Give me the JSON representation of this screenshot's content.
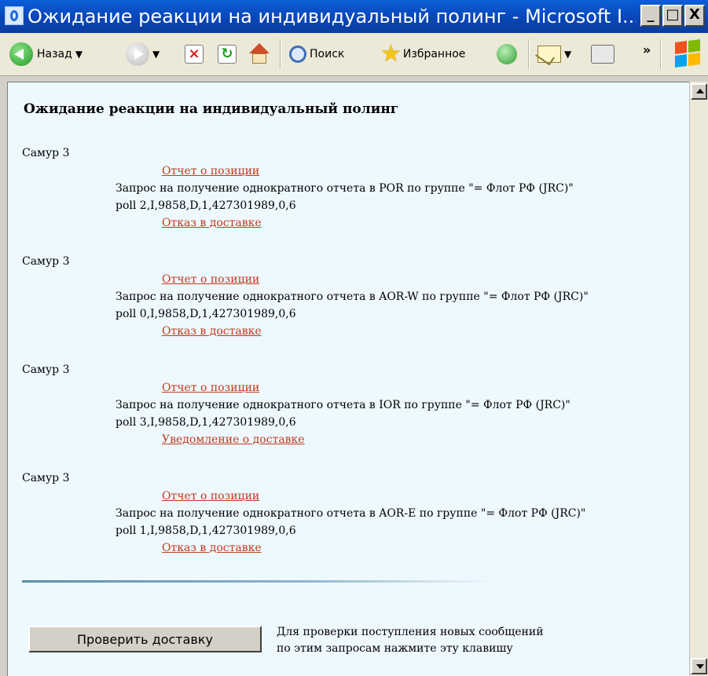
{
  "window": {
    "title": "Ожидание реакции на индивидуальный полинг - Microsoft I...",
    "buttons": {
      "minimize": "_",
      "maximize": "□",
      "close": "X"
    }
  },
  "toolbar": {
    "back_label": "Назад",
    "search_label": "Поиск",
    "favorites_label": "Избранное",
    "chevron": "»"
  },
  "page": {
    "heading": "Ожидание реакции на индивидуальный полинг",
    "entries": [
      {
        "sender": "Самур 3",
        "report_link": "Отчет о позиции",
        "request": "Запрос на получение однократного отчета в POR по группе \"= Флот РФ (JRC)\"",
        "code": "poll 2,I,9858,D,1,427301989,0,6",
        "status_link": "Отказ в доставке"
      },
      {
        "sender": "Самур 3",
        "report_link": "Отчет о позиции",
        "request": "Запрос на получение однократного отчета в AOR-W по группе \"= Флот РФ (JRC)\"",
        "code": "poll 0,I,9858,D,1,427301989,0,6",
        "status_link": "Отказ в доставке"
      },
      {
        "sender": "Самур 3",
        "report_link": "Отчет о позиции",
        "request": "Запрос на получение однократного отчета в IOR по группе \"= Флот РФ (JRC)\"",
        "code": "poll 3,I,9858,D,1,427301989,0,6",
        "status_link": "Уведомление о доставке"
      },
      {
        "sender": "Самур 3",
        "report_link": "Отчет о позиции",
        "request": "Запрос на получение однократного отчета в AOR-E по группе \"= Флот РФ (JRC)\"",
        "code": "poll 1,I,9858,D,1,427301989,0,6",
        "status_link": "Отказ в доставке"
      }
    ],
    "check_button": "Проверить доставку",
    "hint_line1": "Для проверки поступления новых сообщений",
    "hint_line2": "по этим запросам нажмите эту клавишу"
  },
  "colors": {
    "link": "#c0391b",
    "page_background": "#eef8ff",
    "titlebar": "#0846b8"
  }
}
